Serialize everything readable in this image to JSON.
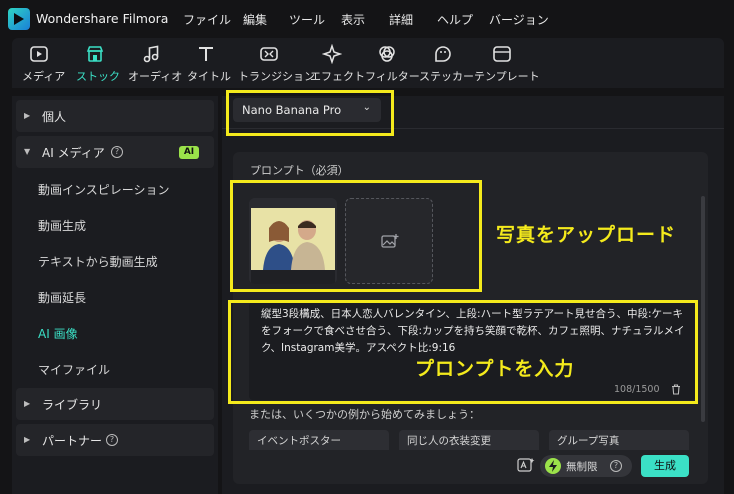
{
  "app": {
    "title": "Wondershare Filmora"
  },
  "menu": [
    "ファイル",
    "編集",
    "ツール",
    "表示",
    "詳細",
    "ヘルプ",
    "バージョン"
  ],
  "toolbar": {
    "tabs": [
      {
        "label": "メディア",
        "icon": "media-icon"
      },
      {
        "label": "ストック",
        "icon": "stock-store-icon",
        "active": true
      },
      {
        "label": "オーディオ",
        "icon": "music-note-icon"
      },
      {
        "label": "タイトル",
        "icon": "title-t-icon"
      },
      {
        "label": "トランジション",
        "icon": "transition-icon"
      },
      {
        "label": "エフェクト",
        "icon": "effect-sparkle-icon"
      },
      {
        "label": "フィルター",
        "icon": "filter-icon"
      },
      {
        "label": "ステッカー",
        "icon": "sticker-icon"
      },
      {
        "label": "テンプレート",
        "icon": "template-icon"
      }
    ]
  },
  "sidebar": {
    "groups": [
      {
        "label": "個人",
        "expanded": false
      },
      {
        "label": "AI メディア",
        "expanded": true,
        "badge": "AI"
      },
      {
        "label": "ライブラリ",
        "expanded": false
      },
      {
        "label": "パートナー",
        "expanded": false
      }
    ],
    "ai_items": [
      "動画インスピレーション",
      "動画生成",
      "テキストから動画生成",
      "動画延長",
      "AI 画像",
      "マイファイル"
    ],
    "active_item": "AI 画像"
  },
  "main": {
    "model_select": "Nano Banana Pro",
    "prompt_label": "プロンプト（必須）",
    "prompt_text": "縦型3段構成、日本人恋人バレンタイン、上段:ハート型ラテアート見せ合う、中段:ケーキをフォークで食べさせ合う、下段:カップを持ち笑顔で乾杯、カフェ照明、ナチュラルメイク、Instagram美学。アスペクト比:9:16",
    "char_count": "108/1500",
    "examples_label": "または、いくつかの例から始めてみましょう：",
    "examples": [
      "イベントポスター",
      "同じ人の衣装変更",
      "グループ写真"
    ],
    "unlimited_label": "無制限",
    "generate_label": "生成"
  },
  "annotations": {
    "upload": "写真をアップロード",
    "prompt": "プロンプトを入力"
  },
  "colors": {
    "accent": "#3be0c6",
    "highlight": "#f4ea1c",
    "ai_badge": "#9be24a"
  }
}
